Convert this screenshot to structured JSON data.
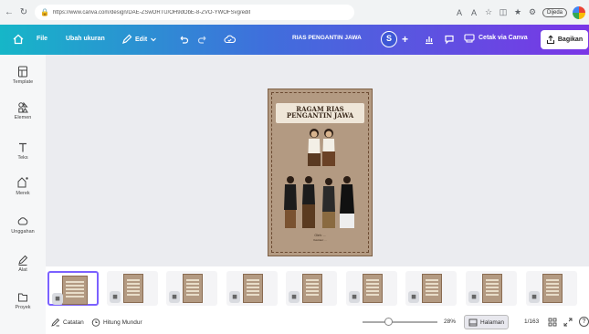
{
  "browser": {
    "url": "https://www.canva.com/design/DAE-ZSwORTU/OH9dObE-8-ZVO-YWOFSvg/edit",
    "paused_label": "Dijeda"
  },
  "toolbar": {
    "file_label": "File",
    "resize_label": "Ubah ukuran",
    "edit_label": "Edit",
    "doc_title": "RIAS PENGANTIN JAWA",
    "avatar_initial": "S",
    "print_label": "Cetak via Canva",
    "share_label": "Bagikan"
  },
  "sidebar": {
    "items": [
      {
        "label": "Template",
        "icon": "template-icon"
      },
      {
        "label": "Elemen",
        "icon": "elements-icon"
      },
      {
        "label": "Teks",
        "icon": "text-icon"
      },
      {
        "label": "Merek",
        "icon": "brand-icon"
      },
      {
        "label": "Unggahan",
        "icon": "upload-icon"
      },
      {
        "label": "Alat",
        "icon": "draw-icon"
      },
      {
        "label": "Proyek",
        "icon": "folder-icon"
      }
    ]
  },
  "page": {
    "title_line1": "RAGAM RIAS",
    "title_line2": "PENGANTIN JAWA",
    "caption": "Oleh: ...",
    "caption2": "Ilustrasi: ..."
  },
  "thumbnails": {
    "count": 10,
    "active_index": 0
  },
  "bottombar": {
    "notes_label": "Catatan",
    "timer_label": "Hitung Mundur",
    "zoom": "28%",
    "pages_label": "Halaman",
    "page_count": "1/163"
  }
}
